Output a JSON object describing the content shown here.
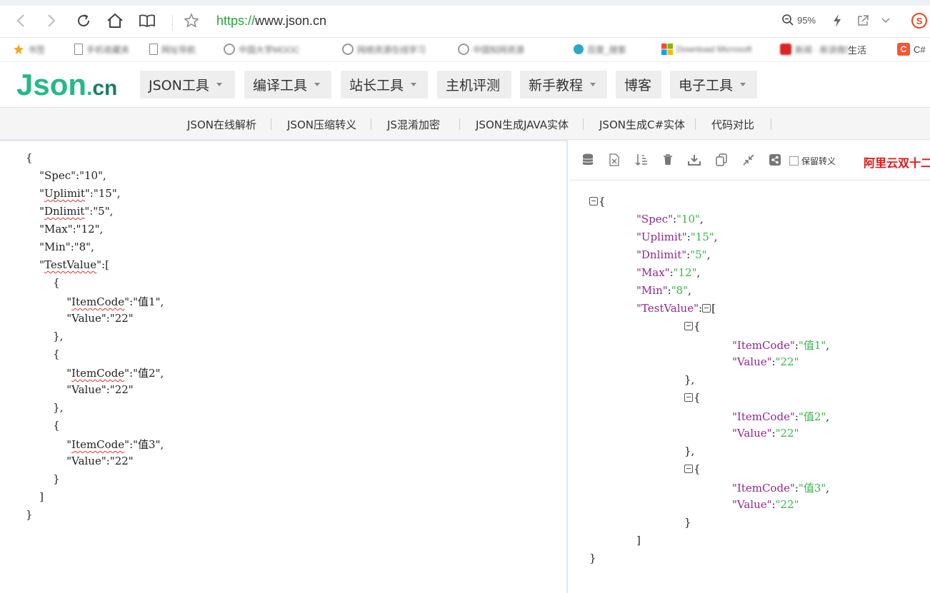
{
  "browser": {
    "url_protocol": "https://",
    "url_host": "www.json.cn",
    "zoom": "95%",
    "bookmarks": [
      {
        "label": "书签",
        "icon": "star-icon",
        "blurred": true
      },
      {
        "label": "手机收藏夹",
        "icon": "page-icon",
        "blurred": true
      },
      {
        "label": "网址导航",
        "icon": "page-icon",
        "blurred": true
      },
      {
        "label": "中国大学MOOC",
        "icon": "globe-icon",
        "blurred": true
      },
      {
        "label": "网络资源在线学习",
        "icon": "globe-icon",
        "blurred": true
      },
      {
        "label": "中国知网资源",
        "icon": "globe-icon",
        "blurred": true
      },
      {
        "label": "百度_搜索",
        "icon": "globe-icon",
        "blurred": true
      },
      {
        "label": "Download Microsoft",
        "icon": "windows-icon",
        "blurred": true
      },
      {
        "label": "生活",
        "icon": "red-icon",
        "blurred": false,
        "prefix": "新闻 · 新浪微博"
      },
      {
        "label": "C#",
        "icon": "csdn-icon",
        "blurred": false
      }
    ]
  },
  "site": {
    "logo_main": "Json",
    "logo_dot": ".",
    "logo_tld": "cn",
    "nav": [
      "JSON工具",
      "编译工具",
      "站长工具",
      "主机评测",
      "新手教程",
      "博客",
      "电子工具"
    ],
    "subnav": [
      "JSON在线解析",
      "JSON压缩转义",
      "JS混淆加密",
      "JSON生成JAVA实体",
      "JSON生成C#实体",
      "代码对比"
    ]
  },
  "editor": {
    "lines": [
      "{",
      "    \"Spec\":\"10\",",
      "    \"Uplimit\":\"15\",",
      "    \"Dnlimit\":\"5\",",
      "    \"Max\":\"12\",",
      "    \"Min\":\"8\",",
      "    \"TestValue\":[",
      "        {",
      "            \"ItemCode\":\"值1\",",
      "            \"Value\":\"22\"",
      "        },",
      "        {",
      "            \"ItemCode\":\"值2\",",
      "            \"Value\":\"22\"",
      "        },",
      "        {",
      "            \"ItemCode\":\"值3\",",
      "            \"Value\":\"22\"",
      "        }",
      "    ]",
      "}"
    ]
  },
  "result": {
    "keep_escape_label": "保留转义",
    "ad_text": "阿里云双十二",
    "pairs": [
      {
        "key": "Spec",
        "value": "10"
      },
      {
        "key": "Uplimit",
        "value": "15"
      },
      {
        "key": "Dnlimit",
        "value": "5"
      },
      {
        "key": "Max",
        "value": "12"
      },
      {
        "key": "Min",
        "value": "8"
      }
    ],
    "array_key": "TestValue",
    "items": [
      {
        "item_code": "值1",
        "value": "22"
      },
      {
        "item_code": "值2",
        "value": "22"
      },
      {
        "item_code": "值3",
        "value": "22"
      }
    ],
    "item_code_key": "ItemCode",
    "value_key": "Value"
  },
  "colors": {
    "logo": "#26b886",
    "json_key": "#92278f",
    "json_string": "#3ab54a",
    "ad": "#e0181b"
  }
}
